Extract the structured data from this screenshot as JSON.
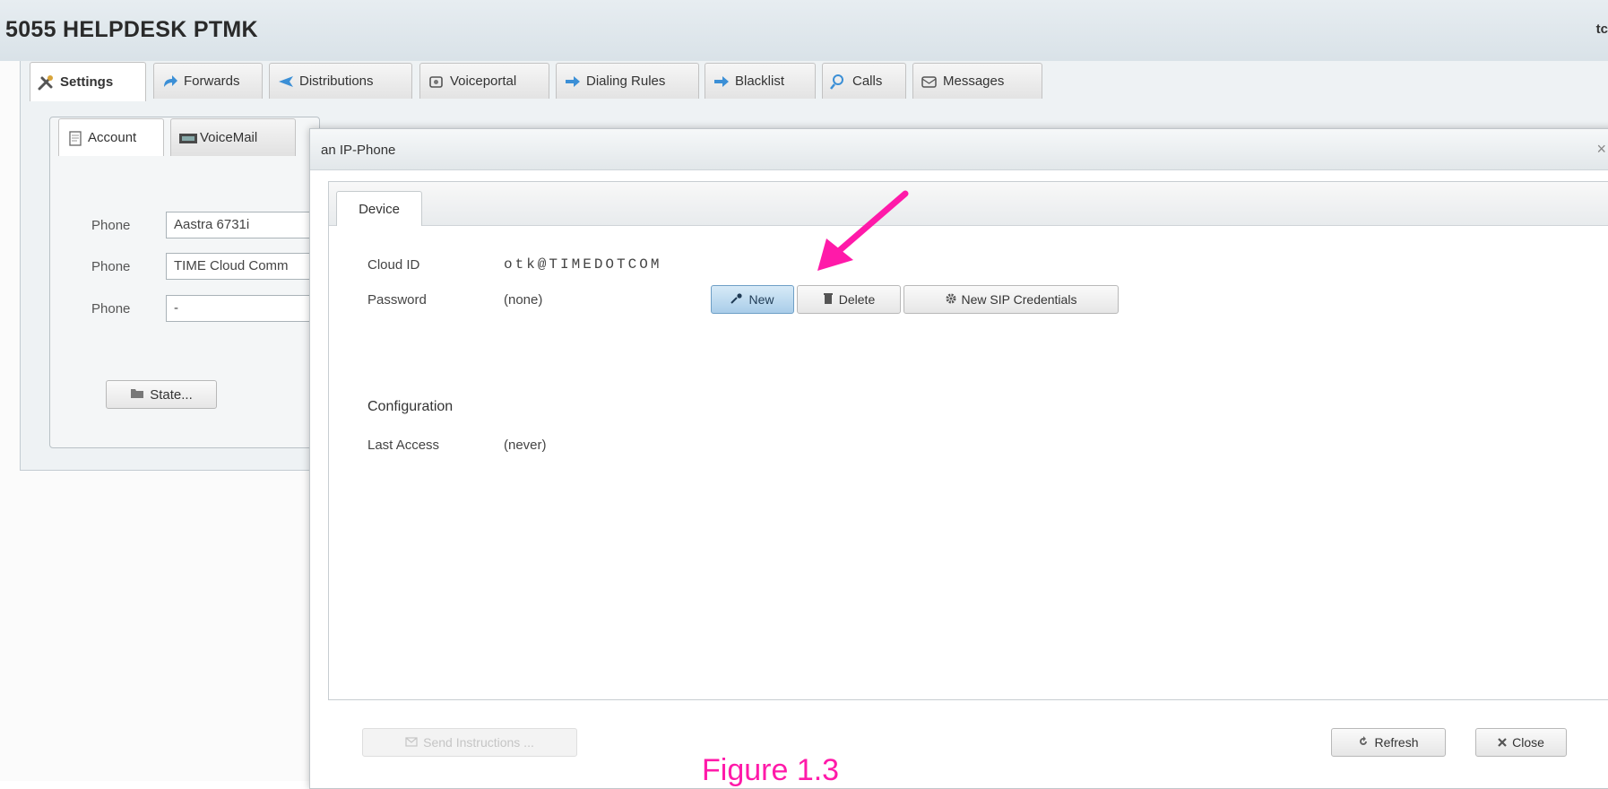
{
  "app": {
    "title": "5055 HELPDESK PTMK",
    "user_text": "tc"
  },
  "main_tabs": [
    {
      "label": "Settings",
      "icon": "tools-icon",
      "active": true
    },
    {
      "label": "Forwards",
      "icon": "forward-arrow-icon"
    },
    {
      "label": "Distributions",
      "icon": "distribution-arrow-icon"
    },
    {
      "label": "Voiceportal",
      "icon": "voiceportal-icon"
    },
    {
      "label": "Dialing Rules",
      "icon": "dialing-rules-arrow-icon"
    },
    {
      "label": "Blacklist",
      "icon": "blacklist-arrow-icon"
    },
    {
      "label": "Calls",
      "icon": "calls-search-icon"
    },
    {
      "label": "Messages",
      "icon": "messages-icon"
    }
  ],
  "settings": {
    "subtabs": [
      {
        "label": "Account",
        "icon": "account-doc-icon",
        "active": true
      },
      {
        "label": "VoiceMail",
        "icon": "voicemail-icon"
      }
    ],
    "phones": [
      {
        "label": "Phone",
        "value": "Aastra 6731i"
      },
      {
        "label": "Phone",
        "value": "TIME Cloud Comm"
      },
      {
        "label": "Phone",
        "value": "-"
      }
    ],
    "state_button": "State..."
  },
  "dialog": {
    "title": "an IP-Phone",
    "close_glyph": "×",
    "tab": "Device",
    "cloud_id_label": "Cloud ID",
    "cloud_id_value": "otk@TIMEDOTCOM",
    "password_label": "Password",
    "password_value": "(none)",
    "buttons": {
      "new": "New",
      "delete": "Delete",
      "new_sip": "New SIP Credentials"
    },
    "configuration_heading": "Configuration",
    "last_access_label": "Last Access",
    "last_access_value": "(never)",
    "footer": {
      "send_instructions": "Send Instructions ...",
      "refresh": "Refresh",
      "close": "Close"
    }
  },
  "annotation": {
    "caption": "Figure 1.3",
    "arrow_color": "#ff1aa9"
  }
}
